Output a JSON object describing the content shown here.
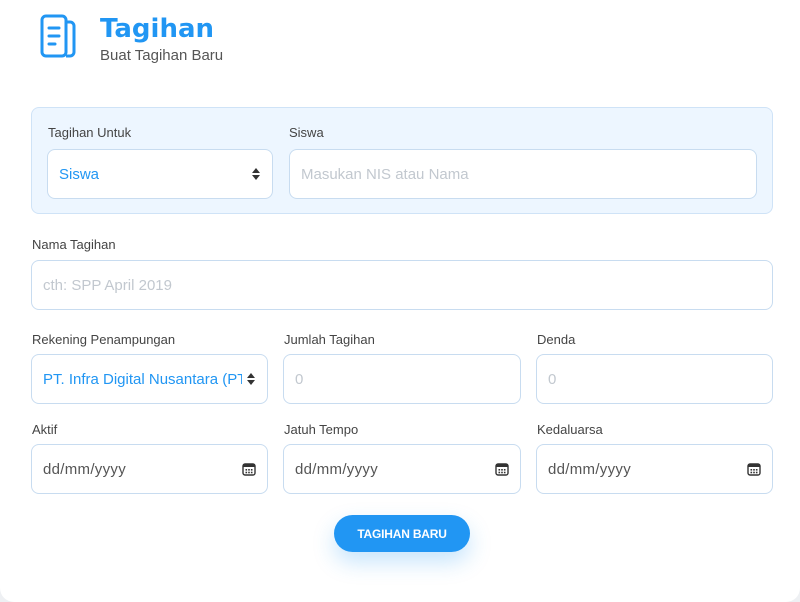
{
  "header": {
    "title": "Tagihan",
    "subtitle": "Buat Tagihan Baru",
    "icon": "document-list-icon",
    "accent_color": "#2196f3"
  },
  "target": {
    "bill_for_label": "Tagihan Untuk",
    "bill_for_value": "Siswa",
    "student_label": "Siswa",
    "student_placeholder": "Masukan NIS atau Nama"
  },
  "bill_name": {
    "label": "Nama Tagihan",
    "placeholder": "cth: SPP April 2019"
  },
  "account": {
    "label": "Rekening Penampungan",
    "value": "PT. Infra Digital Nusantara (PT."
  },
  "amount": {
    "label": "Jumlah Tagihan",
    "placeholder": "0"
  },
  "penalty": {
    "label": "Denda",
    "placeholder": "0"
  },
  "active": {
    "label": "Aktif",
    "placeholder": "dd/mm/yyyy"
  },
  "due": {
    "label": "Jatuh Tempo",
    "placeholder": "dd/mm/yyyy"
  },
  "expiry": {
    "label": "Kedaluarsa",
    "placeholder": "dd/mm/yyyy"
  },
  "submit_label": "TAGIHAN BARU"
}
